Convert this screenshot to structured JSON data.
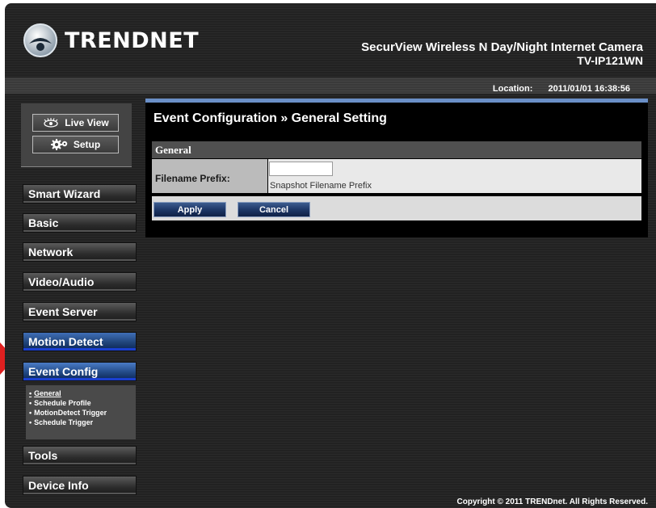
{
  "brand": {
    "logo_text": "TRENDNET"
  },
  "product": {
    "name": "SecurView Wireless N Day/Night Internet Camera",
    "model": "TV-IP121WN"
  },
  "location": {
    "label": "Location:",
    "datetime": "2011/01/01 16:38:56"
  },
  "view_buttons": {
    "live_view": "Live View",
    "setup": "Setup"
  },
  "menu": [
    {
      "label": "Smart Wizard"
    },
    {
      "label": "Basic"
    },
    {
      "label": "Network"
    },
    {
      "label": "Video/Audio"
    },
    {
      "label": "Event Server"
    },
    {
      "label": "Motion Detect"
    },
    {
      "label": "Event Config"
    },
    {
      "label": "Tools"
    },
    {
      "label": "Device Info"
    }
  ],
  "submenu": [
    {
      "label": "General",
      "current": true
    },
    {
      "label": "Schedule Profile"
    },
    {
      "label": "MotionDetect Trigger"
    },
    {
      "label": "Schedule Trigger"
    }
  ],
  "main": {
    "title": "Event Configuration » General Setting",
    "section": "General",
    "field_label": "Filename Prefix:",
    "field_value": "",
    "field_hint": "Snapshot Filename Prefix",
    "apply": "Apply",
    "cancel": "Cancel"
  },
  "footer": "Copyright © 2011 TRENDnet. All Rights Reserved.",
  "colors": {
    "accent_blue": "#6a8fc7",
    "pointer_arrow": "#e02020"
  }
}
